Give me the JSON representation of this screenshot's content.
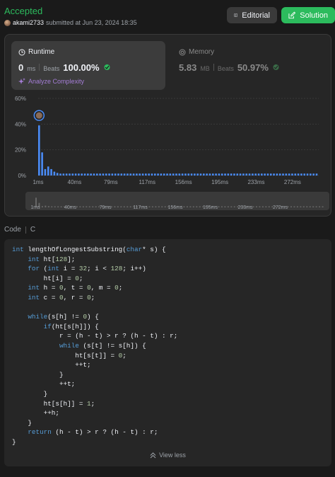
{
  "header": {
    "status": "Accepted",
    "username": "akami2733",
    "submitted_text": "submitted at Jun 23, 2024 18:35",
    "editorial_label": "Editorial",
    "solution_label": "Solution",
    "accent_color": "#2cbb5d"
  },
  "runtime": {
    "title": "Runtime",
    "value": "0",
    "unit": "ms",
    "beats_label": "Beats",
    "beats_value": "100.00%",
    "analyze_label": "Analyze Complexity"
  },
  "memory": {
    "title": "Memory",
    "value": "5.83",
    "unit": "MB",
    "beats_label": "Beats",
    "beats_value": "50.97%"
  },
  "chart_data": {
    "type": "bar",
    "title": "",
    "xlabel": "",
    "ylabel": "",
    "ylim": [
      0,
      60
    ],
    "yticks": [
      "0%",
      "20%",
      "40%",
      "60%"
    ],
    "ytick_values": [
      0,
      20,
      40,
      60
    ],
    "xtick_labels": [
      "1ms",
      "40ms",
      "79ms",
      "117ms",
      "156ms",
      "195ms",
      "233ms",
      "272ms"
    ],
    "values": [
      39,
      18,
      5,
      7,
      5,
      3,
      2,
      1.5,
      1.5,
      1.5,
      1.5,
      1.5,
      1.5,
      1.5,
      1.5,
      1.5,
      1.5,
      1.5,
      1.5,
      1.5,
      1.5,
      1.5,
      1.5,
      1.5,
      1.5,
      1.5,
      1.5,
      1.5,
      1.5,
      1.5,
      1.5,
      1.5,
      1.5,
      1.5,
      1.5,
      1.5,
      1.5,
      1.5,
      1.5,
      1.5,
      1.5,
      1.5,
      1.5,
      1.5,
      1.5,
      1.5,
      1.5,
      1.5,
      1.5,
      1.5,
      1.5,
      1.5,
      1.5,
      1.5,
      1.5,
      1.5,
      1.5,
      1.5,
      1.5,
      1.5,
      1.5,
      1.5,
      1.5,
      1.5,
      1.5,
      1.5,
      1.5,
      1.5,
      1.5,
      1.5,
      1.5,
      1.5,
      1.5,
      1.5,
      1.5,
      1.5,
      1.5,
      1.5,
      1.5,
      1.5,
      1.5,
      1.5,
      1.5,
      1.5,
      1.5,
      1.5,
      1.5,
      1.5,
      1.5,
      1.5,
      1.5,
      1.5
    ],
    "highlight_index": 0,
    "bar_color": "#4a8cf7",
    "grid": true
  },
  "brush": {
    "xtick_labels": [
      "1ms",
      "40ms",
      "79ms",
      "117ms",
      "156ms",
      "195ms",
      "233ms",
      "272ms"
    ]
  },
  "code": {
    "tab_label": "Code",
    "language": "C",
    "lines": [
      "int lengthOfLongestSubstring(char* s) {",
      "    int ht[128];",
      "    for (int i = 32; i < 128; i++)",
      "        ht[i] = 0;",
      "    int h = 0, t = 0, m = 0;",
      "    int c = 0, r = 0;",
      "",
      "    while(s[h] != 0) {",
      "        if(ht[s[h]]) {",
      "            r = (h - t) > r ? (h - t) : r;",
      "            while (s[t] != s[h]) {",
      "                ht[s[t]] = 0;",
      "                ++t;",
      "            }",
      "            ++t;",
      "        }",
      "        ht[s[h]] = 1;",
      "        ++h;",
      "    }",
      "    return (h - t) > r ? (h - t) : r;",
      "}"
    ],
    "view_less_label": "View less"
  }
}
